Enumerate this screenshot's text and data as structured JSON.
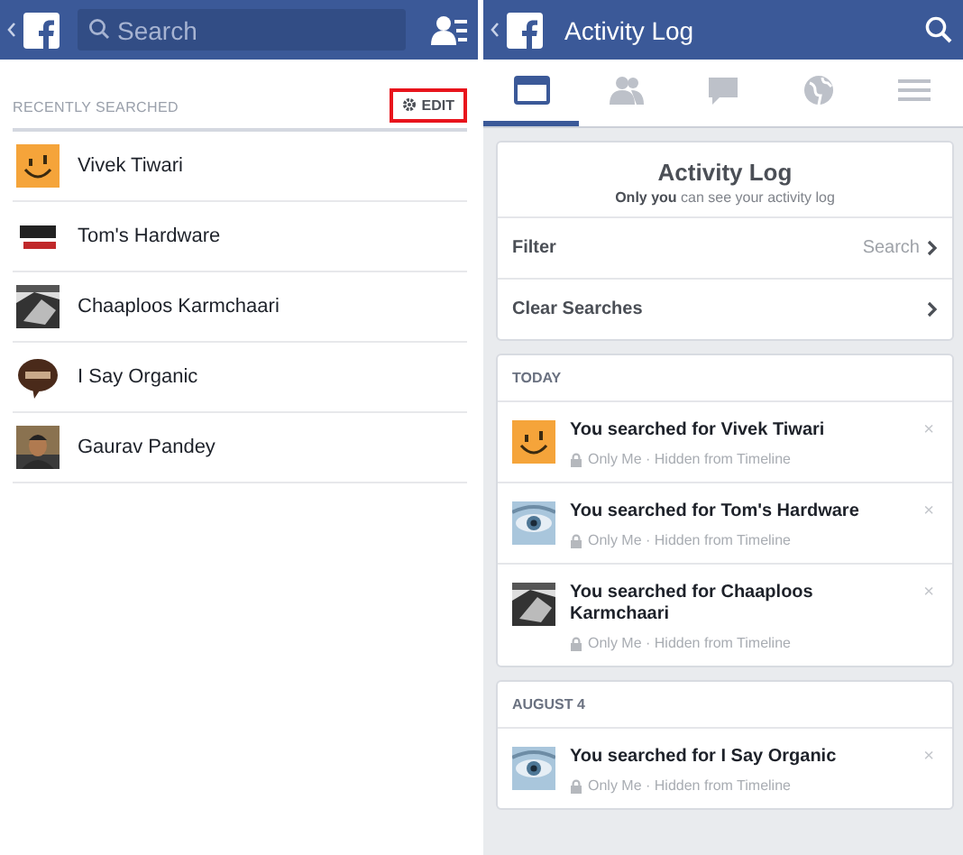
{
  "left": {
    "search": {
      "placeholder": "Search"
    },
    "section_title": "RECENTLY SEARCHED",
    "edit_button": {
      "label": "EDIT",
      "highlighted": true
    },
    "recent": [
      {
        "name": "Vivek Tiwari"
      },
      {
        "name": "Tom's Hardware"
      },
      {
        "name": "Chaaploos Karmchaari"
      },
      {
        "name": "I Say Organic"
      },
      {
        "name": "Gaurav Pandey"
      }
    ]
  },
  "right": {
    "title": "Activity Log",
    "tabs": [
      {
        "kind": "log",
        "selected": true
      },
      {
        "kind": "friends",
        "selected": false
      },
      {
        "kind": "messages",
        "selected": false
      },
      {
        "kind": "globe",
        "selected": false
      },
      {
        "kind": "menu",
        "selected": false
      }
    ],
    "header_card": {
      "title": "Activity Log",
      "subtitle": "**Only you** can see your activity log",
      "rows": [
        {
          "label": "Filter",
          "value": "Search"
        },
        {
          "label": "Clear Searches"
        }
      ]
    },
    "sections": [
      {
        "heading": "TODAY",
        "items": [
          {
            "text": "You searched for Vivek Tiwari",
            "meta": "Only Me · Hidden from Timeline",
            "close": "×"
          },
          {
            "text": "You searched for Tom's Hardware",
            "meta": "Only Me · Hidden from Timeline",
            "close": "×"
          },
          {
            "text": "You searched for Chaaploos Karmchaari",
            "meta": "Only Me · Hidden from Timeline",
            "close": "×"
          }
        ]
      },
      {
        "heading": "AUGUST 4",
        "items": [
          {
            "text": "You searched for I Say Organic",
            "meta": "Only Me · Hidden from Timeline",
            "close": "×"
          }
        ]
      }
    ]
  }
}
